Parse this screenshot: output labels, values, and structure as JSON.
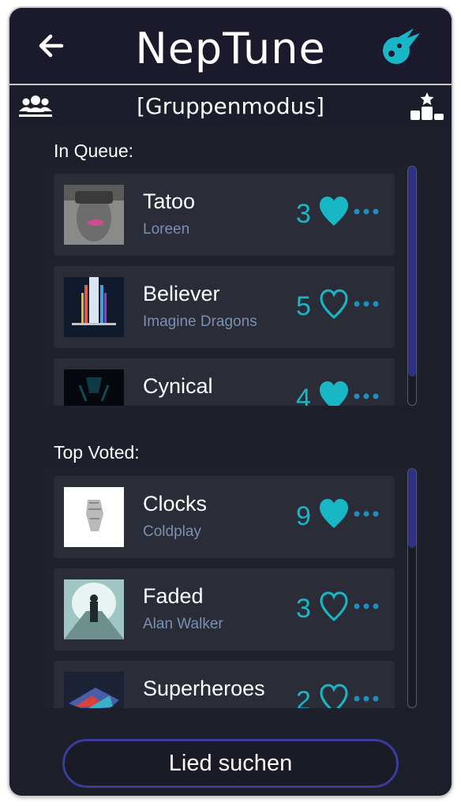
{
  "app": {
    "title": "NepTune"
  },
  "mode": {
    "label": "[Gruppenmodus]"
  },
  "colors": {
    "accent": "#19b7c6",
    "background": "#1a1c27",
    "card": "#2a2c38",
    "scroll_thumb": "#2f3185",
    "button_border": "#3b3c9a"
  },
  "icons": {
    "back": "arrow-left-icon",
    "logo": "comet-logo-icon",
    "group": "group-users-icon",
    "ranking": "podium-star-icon",
    "vote_filled": "heart-filled-icon",
    "vote_empty": "heart-outline-icon",
    "more": "more-dots-icon"
  },
  "queue": {
    "title": "In Queue:",
    "items": [
      {
        "title": "Tatoo",
        "artist": "Loreen",
        "votes": "3",
        "liked": true
      },
      {
        "title": "Believer",
        "artist": "Imagine Dragons",
        "votes": "5",
        "liked": false
      },
      {
        "title": "Cynical",
        "artist": "",
        "votes": "4",
        "liked": true
      }
    ]
  },
  "top": {
    "title": "Top Voted:",
    "items": [
      {
        "title": "Clocks",
        "artist": "Coldplay",
        "votes": "9",
        "liked": true
      },
      {
        "title": "Faded",
        "artist": "Alan Walker",
        "votes": "3",
        "liked": false
      },
      {
        "title": "Superheroes",
        "artist": "",
        "votes": "2",
        "liked": false
      }
    ]
  },
  "search_button": {
    "label": "Lied suchen"
  }
}
